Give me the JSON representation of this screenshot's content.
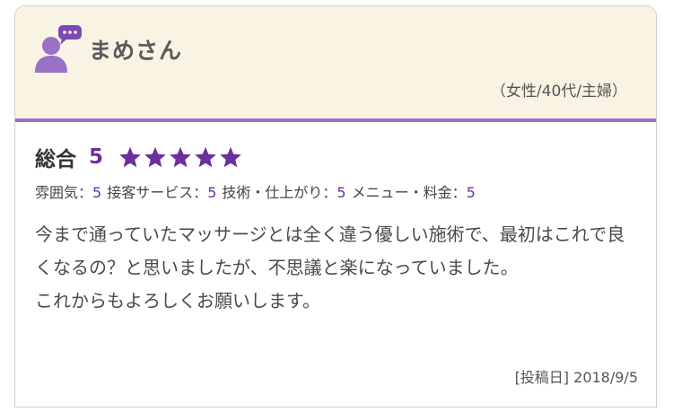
{
  "review": {
    "reviewer_name": "まめさん",
    "reviewer_profile": "（女性/40代/主婦）",
    "avatar_icon": "person-with-speech-bubble-icon",
    "overall_label": "総合",
    "overall_score": "5",
    "stars_rating": 5,
    "stars_max": 5,
    "star_color": "#6b2f9e",
    "sub_scores": [
      {
        "label": "雰囲気：",
        "value": "5"
      },
      {
        "label": "接客サービス：",
        "value": "5"
      },
      {
        "label": "技術・仕上がり：",
        "value": "5"
      },
      {
        "label": "メニュー・料金：",
        "value": "5"
      }
    ],
    "comment": "今まで通っていたマッサージとは全く違う優しい施術で、最初はこれで良くなるの？と思いましたが、不思議と楽になっていました。\nこれからもよろしくお願いします。",
    "posted_date": "[投稿日] 2018/9/5"
  },
  "colors": {
    "header_bg": "#f8f3e2",
    "accent": "#9a70c8",
    "score_text": "#6b2f9e"
  }
}
